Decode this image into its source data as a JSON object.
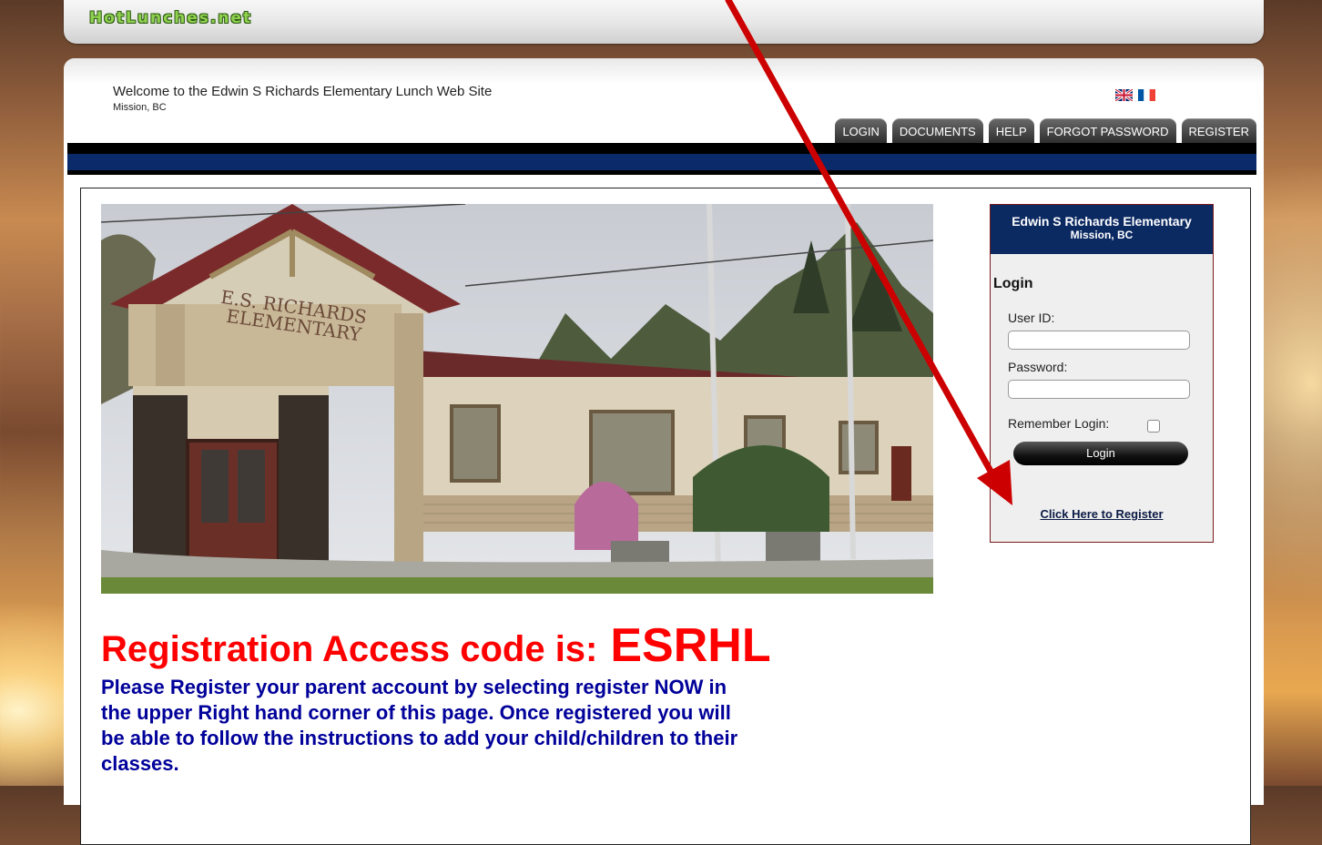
{
  "header": {
    "logo": "HotLunches.net"
  },
  "site": {
    "welcome": "Welcome to the Edwin S Richards Elementary Lunch Web Site",
    "location": "Mission, BC"
  },
  "languages": [
    {
      "icon": "uk-flag-icon"
    },
    {
      "icon": "france-flag-icon"
    }
  ],
  "tabs": [
    "LOGIN",
    "DOCUMENTS",
    "HELP",
    "FORGOT PASSWORD",
    "REGISTER"
  ],
  "photo": {
    "sign": "E.S. RICHARDS ELEMENTARY"
  },
  "registration": {
    "label": "Registration Access code is:",
    "code": "ESRHL",
    "instructions": "Please Register your parent account by selecting register NOW in the upper Right hand corner of this page.  Once registered you will be able to follow the instructions to add your child/children to their classes."
  },
  "login": {
    "school": "Edwin S Richards Elementary",
    "school_location": "Mission, BC",
    "title": "Login",
    "user_label": "User ID:",
    "user_value": "",
    "password_label": "Password:",
    "password_value": "",
    "remember_label": "Remember Login:",
    "remember_checked": false,
    "button": "Login",
    "register_link": "Click Here to Register"
  },
  "colors": {
    "accent_red": "#ff0000",
    "instruction_blue": "#00009a",
    "nav_blue": "#0a2a6a",
    "arrow": "#cc0000"
  }
}
